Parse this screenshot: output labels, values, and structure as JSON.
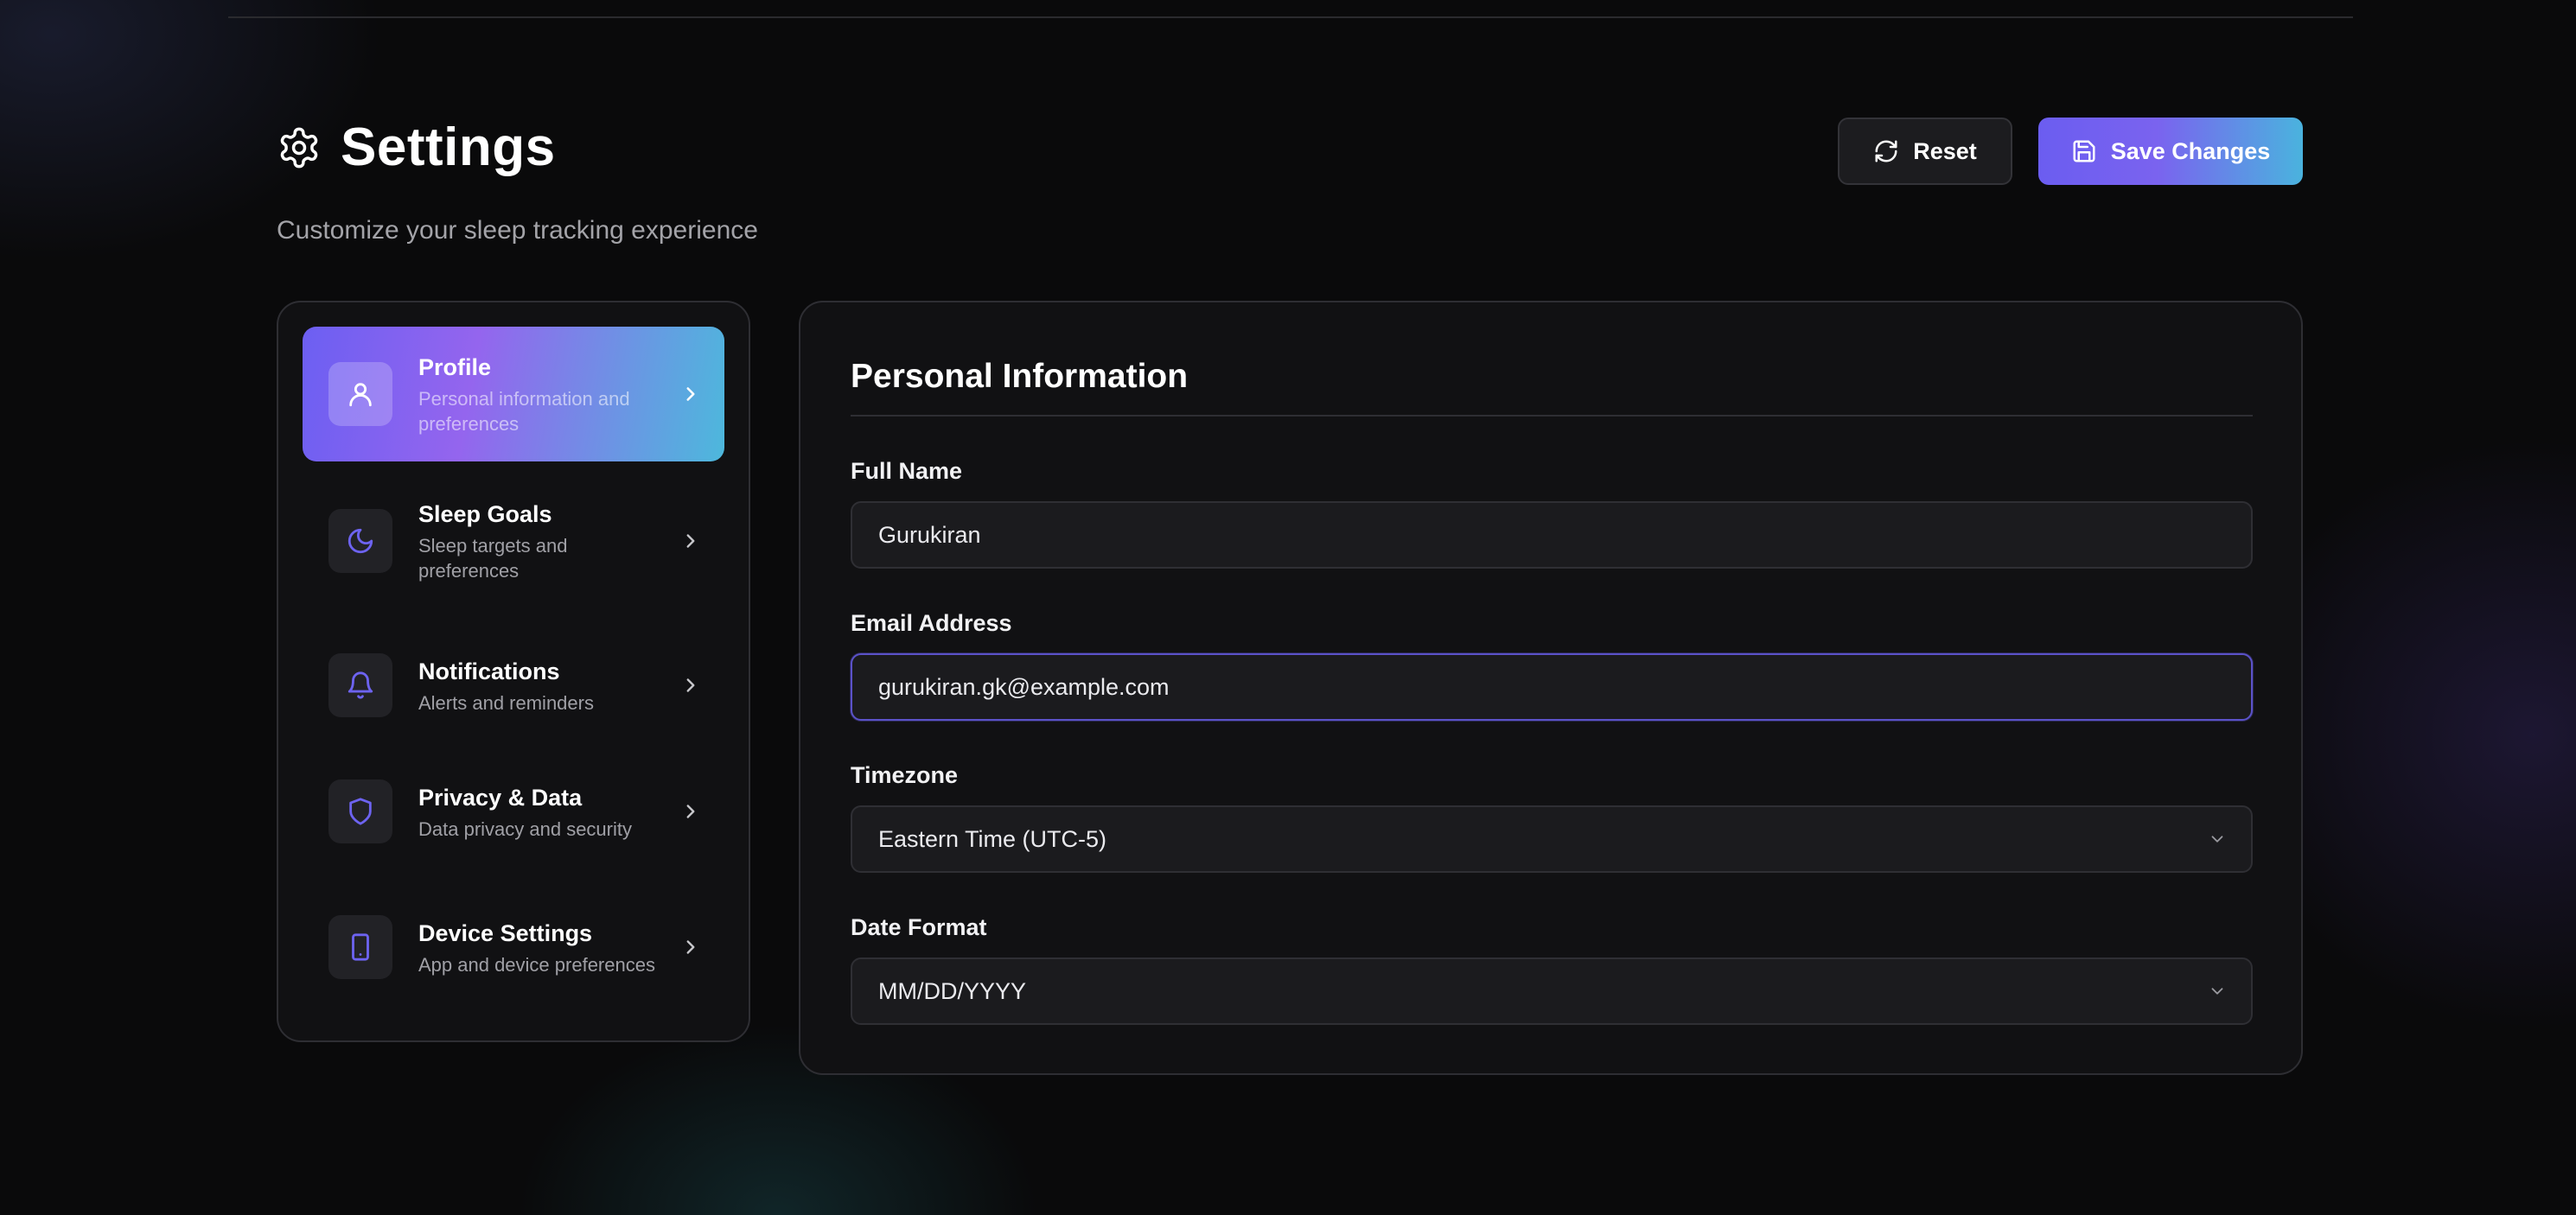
{
  "header": {
    "title": "Settings",
    "subtitle": "Customize your sleep tracking experience",
    "reset_label": "Reset",
    "save_label": "Save Changes"
  },
  "sidebar": {
    "items": [
      {
        "label": "Profile",
        "description": "Personal information and preferences",
        "icon": "user-icon",
        "active": true
      },
      {
        "label": "Sleep Goals",
        "description": "Sleep targets and preferences",
        "icon": "moon-icon",
        "active": false
      },
      {
        "label": "Notifications",
        "description": "Alerts and reminders",
        "icon": "bell-icon",
        "active": false
      },
      {
        "label": "Privacy & Data",
        "description": "Data privacy and security",
        "icon": "shield-icon",
        "active": false
      },
      {
        "label": "Device Settings",
        "description": "App and device preferences",
        "icon": "smartphone-icon",
        "active": false
      }
    ]
  },
  "main": {
    "section_title": "Personal Information",
    "fields": {
      "full_name": {
        "label": "Full Name",
        "value": "Gurukiran"
      },
      "email": {
        "label": "Email Address",
        "value": "gurukiran.gk@example.com"
      },
      "timezone": {
        "label": "Timezone",
        "value": "Eastern Time (UTC-5)"
      },
      "date_format": {
        "label": "Date Format",
        "value": "MM/DD/YYYY"
      }
    }
  },
  "colors": {
    "background": "#0a0a0b",
    "panel": "#111113",
    "accent_start": "#6c5ff2",
    "accent_end": "#4db8dc",
    "icon_accent": "#6d63f0",
    "focus_border": "#5b52c9"
  }
}
